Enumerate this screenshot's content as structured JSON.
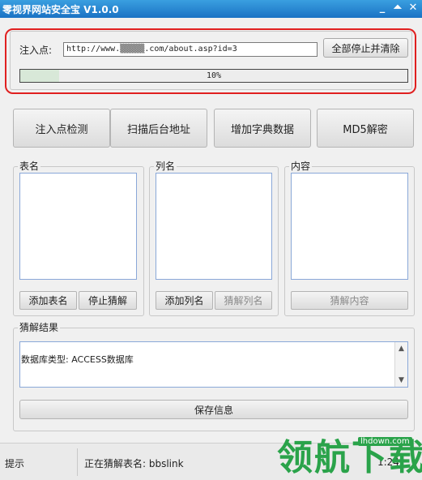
{
  "window": {
    "title": "零视界网站安全宝 V1.0.0",
    "min_glyph": "_",
    "restore_glyph": "⏶",
    "close_glyph": "✕"
  },
  "inject": {
    "label": "注入点:",
    "url_value": "http://www.▒▒▒▒▒.com/about.asp?id=3",
    "stop_button": "全部停止并清除",
    "progress_percent": 10,
    "progress_text": "10%"
  },
  "actions": {
    "detect": "注入点检测",
    "scan_admin": "扫描后台地址",
    "add_dict": "增加字典数据",
    "md5": "MD5解密"
  },
  "panels": {
    "tables": {
      "label": "表名",
      "add_button": "添加表名",
      "stop_button": "停止猜解"
    },
    "columns": {
      "label": "列名",
      "add_button": "添加列名",
      "guess_button": "猜解列名"
    },
    "content": {
      "label": "内容",
      "guess_button": "猜解内容"
    }
  },
  "result": {
    "label": "猜解结果",
    "text": "数据库类型: ACCESS数据库",
    "save_button": "保存信息"
  },
  "status": {
    "hint": "提示",
    "message": "正在猜解表名: bbslink",
    "time": "1:24"
  },
  "watermark": {
    "text": "领航下载",
    "url": "lhdown.com"
  },
  "colors": {
    "titlebar": "#1a72c4",
    "highlight_frame": "#e02020",
    "watermark": "#2aa34a"
  }
}
